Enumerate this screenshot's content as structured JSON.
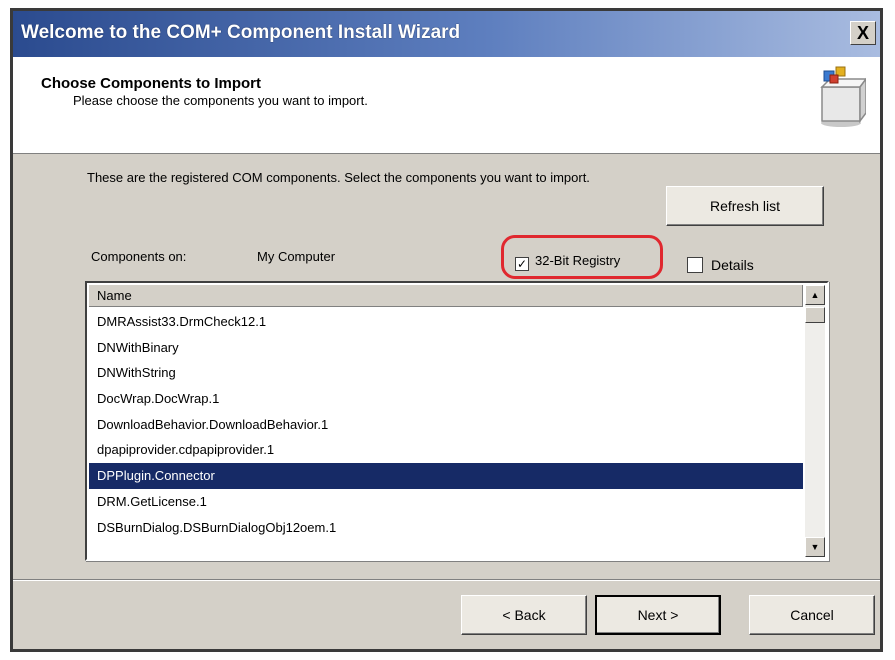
{
  "window": {
    "title": "Welcome to the COM+ Component Install Wizard",
    "close_label": "X"
  },
  "header": {
    "title": "Choose Components to Import",
    "subtitle": "Please choose the components you want to import."
  },
  "body": {
    "intro": "These are the registered COM components. Select the components you want to import.",
    "refresh_label": "Refresh list",
    "components_on_label": "Components on:",
    "components_on_value": "My Computer",
    "registry_label": "32-Bit Registry",
    "registry_checked": true,
    "details_label": "Details",
    "details_checked": false,
    "highlight_color": "#e0282f"
  },
  "list": {
    "header": "Name",
    "items": [
      "DMRAssist33.DrmCheck12.1",
      "DNWithBinary",
      "DNWithString",
      "DocWrap.DocWrap.1",
      "DownloadBehavior.DownloadBehavior.1",
      "dpapiprovider.cdpapiprovider.1",
      "DPPlugin.Connector",
      "DRM.GetLicense.1",
      "DSBurnDialog.DSBurnDialogObj12oem.1"
    ],
    "selected_index": 6,
    "selected_color": "#162a66"
  },
  "footer": {
    "back_label": "< Back",
    "next_label": "Next >",
    "cancel_label": "Cancel"
  },
  "icons": {
    "close": "close-icon",
    "wizard": "component-box-icon",
    "scroll_up": "scroll-up-arrow-icon",
    "scroll_down": "scroll-down-arrow-icon",
    "checkmark": "checkmark-icon"
  }
}
